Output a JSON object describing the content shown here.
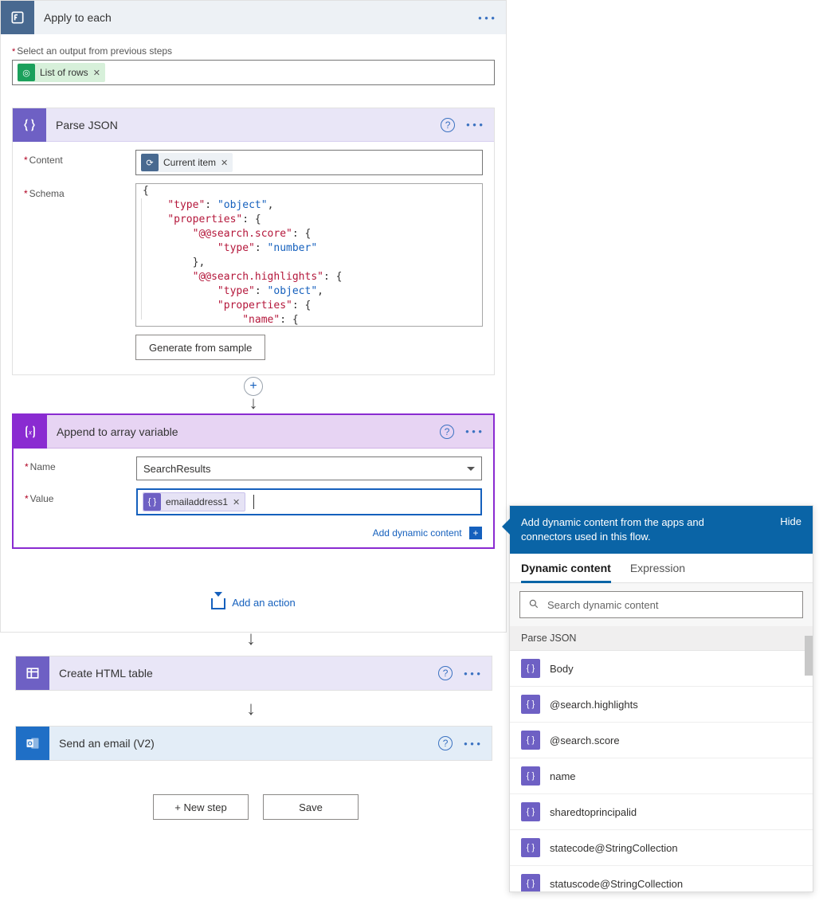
{
  "applyEach": {
    "title": "Apply to each",
    "selectLabel": "Select an output from previous steps",
    "chip": "List of rows"
  },
  "parseJson": {
    "title": "Parse JSON",
    "contentLabel": "Content",
    "contentChip": "Current item",
    "schemaLabel": "Schema",
    "generateBtn": "Generate from sample",
    "schema": {
      "l1": "{",
      "l2a": "\"type\"",
      "l2b": ": ",
      "l2c": "\"object\"",
      "l2d": ",",
      "l3a": "\"properties\"",
      "l3b": ": {",
      "l4a": "\"@@search.score\"",
      "l4b": ": {",
      "l5a": "\"type\"",
      "l5b": ": ",
      "l5c": "\"number\"",
      "l6": "},",
      "l7a": "\"@@search.highlights\"",
      "l7b": ": {",
      "l8a": "\"type\"",
      "l8b": ": ",
      "l8c": "\"object\"",
      "l8d": ",",
      "l9a": "\"properties\"",
      "l9b": ": {",
      "l10a": "\"name\"",
      "l10b": ": {"
    }
  },
  "append": {
    "title": "Append to array variable",
    "nameLabel": "Name",
    "nameValue": "SearchResults",
    "valueLabel": "Value",
    "valueChip": "emailaddress1",
    "addContent": "Add dynamic content"
  },
  "addAction": "Add an action",
  "createHtml": {
    "title": "Create HTML table"
  },
  "sendEmail": {
    "title": "Send an email (V2)"
  },
  "buttons": {
    "newStep": "+ New step",
    "save": "Save"
  },
  "dyn": {
    "headMsg": "Add dynamic content from the apps and connectors used in this flow.",
    "hide": "Hide",
    "tabDynamic": "Dynamic content",
    "tabExpression": "Expression",
    "searchPlaceholder": "Search dynamic content",
    "group": "Parse JSON",
    "items": [
      "Body",
      "@search.highlights",
      "@search.score",
      "name",
      "sharedtoprincipalid",
      "statecode@StringCollection",
      "statuscode@StringCollection"
    ]
  }
}
